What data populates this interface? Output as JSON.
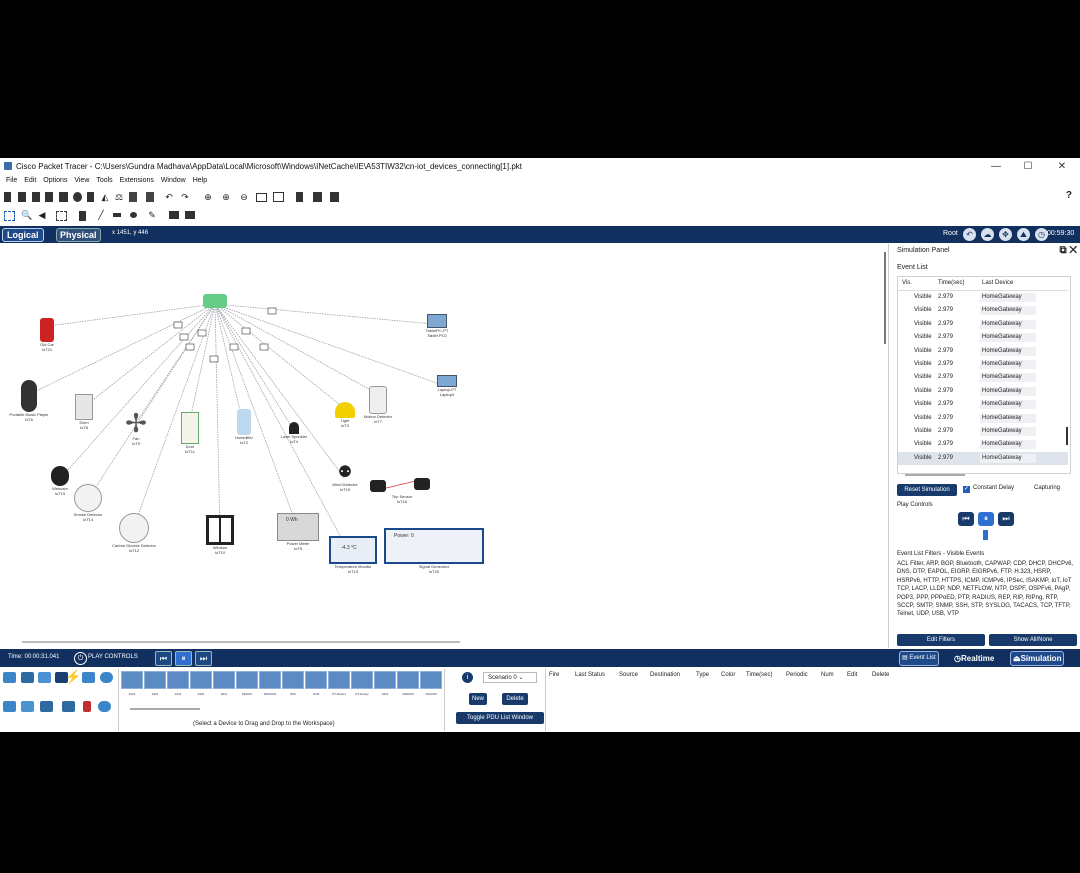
{
  "window": {
    "title": "Cisco Packet Tracer - C:\\Users\\Gundra Madhava\\AppData\\Local\\Microsoft\\Windows\\INetCache\\IE\\A53TIW32\\cn-iot_devices_connecting[1].pkt",
    "minimize": "—",
    "maximize": "☐",
    "close": "✕"
  },
  "menu": [
    "File",
    "Edit",
    "Options",
    "View",
    "Tools",
    "Extensions",
    "Window",
    "Help"
  ],
  "toolbar": {
    "help": "?"
  },
  "modebar": {
    "logical": "Logical",
    "physical": "Physical",
    "coords": "x 1451, y 446",
    "root": "Root",
    "clock": "00:59:30"
  },
  "devices": [
    {
      "name": "Old Car",
      "id": "IoT21"
    },
    {
      "name": "Portable Music Player",
      "id": "IoT6"
    },
    {
      "name": "Siren",
      "id": "IoT8"
    },
    {
      "name": "Fan",
      "id": "IoT9"
    },
    {
      "name": "Door",
      "id": "IoT11"
    },
    {
      "name": "Humidifier",
      "id": "IoT2"
    },
    {
      "name": "Lawn Sprinkler",
      "id": "IoT4"
    },
    {
      "name": "Light",
      "id": "IoT3"
    },
    {
      "name": "Motion Detector",
      "id": "IoT7"
    },
    {
      "name": "Webcam",
      "id": "IoT15"
    },
    {
      "name": "Smoke Detector",
      "id": "IoT14"
    },
    {
      "name": "Carbon Dioxide Detector",
      "id": "IoT12"
    },
    {
      "name": "Window",
      "id": "IoT10"
    },
    {
      "name": "Power Meter",
      "id": "IoT5"
    },
    {
      "name": "Wind Detector",
      "id": "IoT19"
    },
    {
      "name": "Trip Sensor",
      "id": "IoT16"
    },
    {
      "name": "Temperature Monitor",
      "id": "IoT13"
    },
    {
      "name": "Signal Generator",
      "id": "IoT20"
    },
    {
      "name": "TabletPC-PT",
      "id": "Tablet PC0"
    },
    {
      "name": "Laptop-PT",
      "id": "Laptop0"
    },
    {
      "name": "Home Gateway",
      "id": ""
    }
  ],
  "power_meter_readout": "0 Wh",
  "temp_monitor_readout": "-4.3 °C",
  "signal_gen_readout": "Power: 0",
  "simulation": {
    "panel_title": "Simulation Panel",
    "event_list_title": "Event List",
    "columns": [
      "Vis.",
      "Time(sec)",
      "Last Device"
    ],
    "events": [
      {
        "vis": "Visible",
        "time": "2.979",
        "device": "HomeGateway"
      },
      {
        "vis": "Visible",
        "time": "2.979",
        "device": "HomeGateway"
      },
      {
        "vis": "Visible",
        "time": "2.979",
        "device": "HomeGateway"
      },
      {
        "vis": "Visible",
        "time": "2.979",
        "device": "HomeGateway"
      },
      {
        "vis": "Visible",
        "time": "2.979",
        "device": "HomeGateway"
      },
      {
        "vis": "Visible",
        "time": "2.979",
        "device": "HomeGateway"
      },
      {
        "vis": "Visible",
        "time": "2.979",
        "device": "HomeGateway"
      },
      {
        "vis": "Visible",
        "time": "2.979",
        "device": "HomeGateway"
      },
      {
        "vis": "Visible",
        "time": "2.979",
        "device": "HomeGateway"
      },
      {
        "vis": "Visible",
        "time": "2.979",
        "device": "HomeGateway"
      },
      {
        "vis": "Visible",
        "time": "2.979",
        "device": "HomeGateway"
      },
      {
        "vis": "Visible",
        "time": "2.979",
        "device": "HomeGateway"
      },
      {
        "vis": "Visible",
        "time": "2.979",
        "device": "HomeGateway"
      }
    ],
    "reset": "Reset Simulation",
    "constant_delay": "Constant Delay",
    "capturing": "Capturing",
    "play_controls": "Play Controls",
    "filters_title": "Event List Filters - Visible Events",
    "filters": "ACL Filter, ARP, BGP, Bluetooth, CAPWAP, CDP, DHCP, DHCPv6, DNS, DTP, EAPOL, EIGRP, EIGRPv6, FTP, H.323, HSRP, HSRPv6, HTTP, HTTPS, ICMP, ICMPv6, IPSec, ISAKMP, IoT, IoT TCP, LACP, LLDP, NDP, NETFLOW, NTP, OSPF, OSPFv6, PAgP, POP3, PPP, PPPoED, PTP, RADIUS, REP, RIP, RIPng, RTP, SCCP, SMTP, SNMP, SSH, STP, SYSLOG, TACACS, TCP, TFTP, Telnet, UDP, USB, VTP",
    "edit_filters": "Edit Filters",
    "show_all": "Show All/None"
  },
  "statusbar": {
    "time": "Time: 00:00:31.041",
    "play_controls": "PLAY CONTROLS",
    "event_list": "Event List",
    "realtime": "Realtime",
    "simulation": "Simulation"
  },
  "palette": {
    "device_labels": [
      "4331",
      "4321",
      "1941",
      "2901",
      "2911",
      "819IOX",
      "819HGW",
      "829",
      "1240",
      "PT-Router",
      "PT-Empty",
      "1841",
      "2620XM",
      "2621XM"
    ],
    "hint": "(Select a Device to Drag and Drop to the Workspace)"
  },
  "pdu": {
    "scenario": "Scenario 0",
    "new": "New",
    "delete": "Delete",
    "toggle": "Toggle PDU List Window",
    "columns": [
      "Fire",
      "Last Status",
      "Source",
      "Destination",
      "Type",
      "Color",
      "Time(sec)",
      "Periodic",
      "Num",
      "Edit",
      "Delete"
    ]
  },
  "colors": {
    "navy": "#11305f",
    "accent": "#173a6b",
    "link": "#9aa0a8"
  }
}
